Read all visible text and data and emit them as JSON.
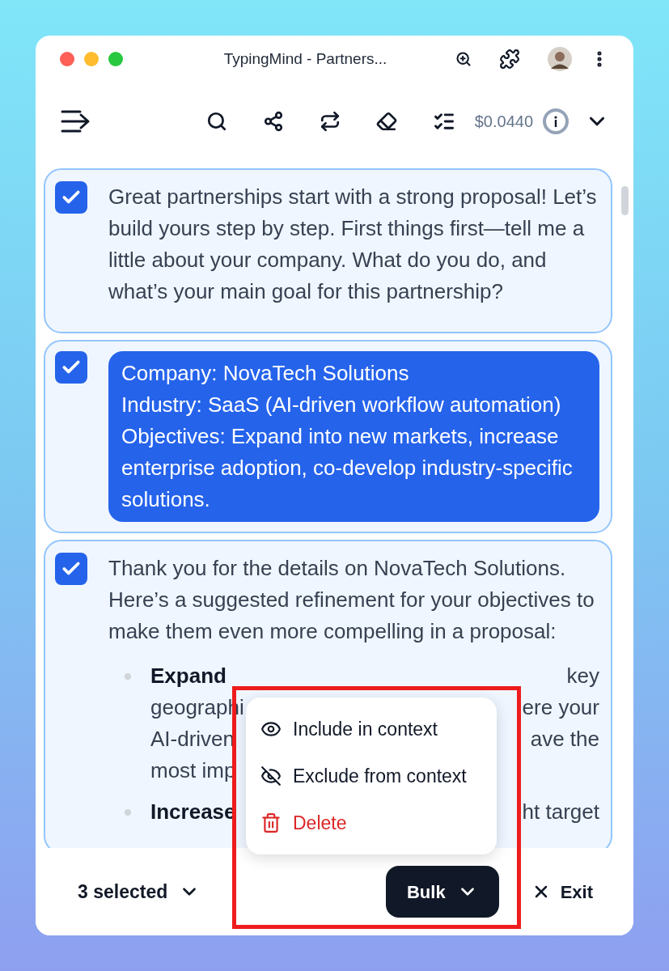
{
  "window": {
    "title": "TypingMind - Partners..."
  },
  "toolbar": {
    "cost": "$0.0440"
  },
  "messages": [
    {
      "kind": "assistant",
      "checked": true,
      "text": "Great partnerships start with a strong proposal! Let’s build yours step by step. First things first—tell me a little about your company. What do you do, and what’s your main goal for this partnership?"
    },
    {
      "kind": "user",
      "checked": true,
      "lines": [
        "Company: NovaTech Solutions",
        "Industry: SaaS (AI-driven workflow automation)",
        "Objectives: Expand into new markets, increase enterprise adoption, co-develop industry-specific solutions."
      ]
    },
    {
      "kind": "assistant",
      "checked": true,
      "text": "Thank you for the details on NovaTech Solutions. Here’s a suggested refinement for your objectives to make them even more compelling in a proposal:",
      "bullets": [
        {
          "rows": [
            {
              "left": "Expand",
              "right": "key"
            },
            {
              "left": "geographi",
              "right": "ere your"
            },
            {
              "left": "AI-driven",
              "right": "ave the"
            },
            {
              "left": "most imp",
              "right": ""
            }
          ]
        },
        {
          "rows": [
            {
              "left": "Increase",
              "right": "ht target"
            }
          ]
        }
      ]
    }
  ],
  "menu": {
    "items": [
      {
        "kind": "include",
        "label": "Include in context"
      },
      {
        "kind": "exclude",
        "label": "Exclude from context"
      },
      {
        "kind": "delete",
        "label": "Delete"
      }
    ]
  },
  "footer": {
    "selection": "3 selected",
    "bulk": "Bulk",
    "exit": "Exit"
  }
}
